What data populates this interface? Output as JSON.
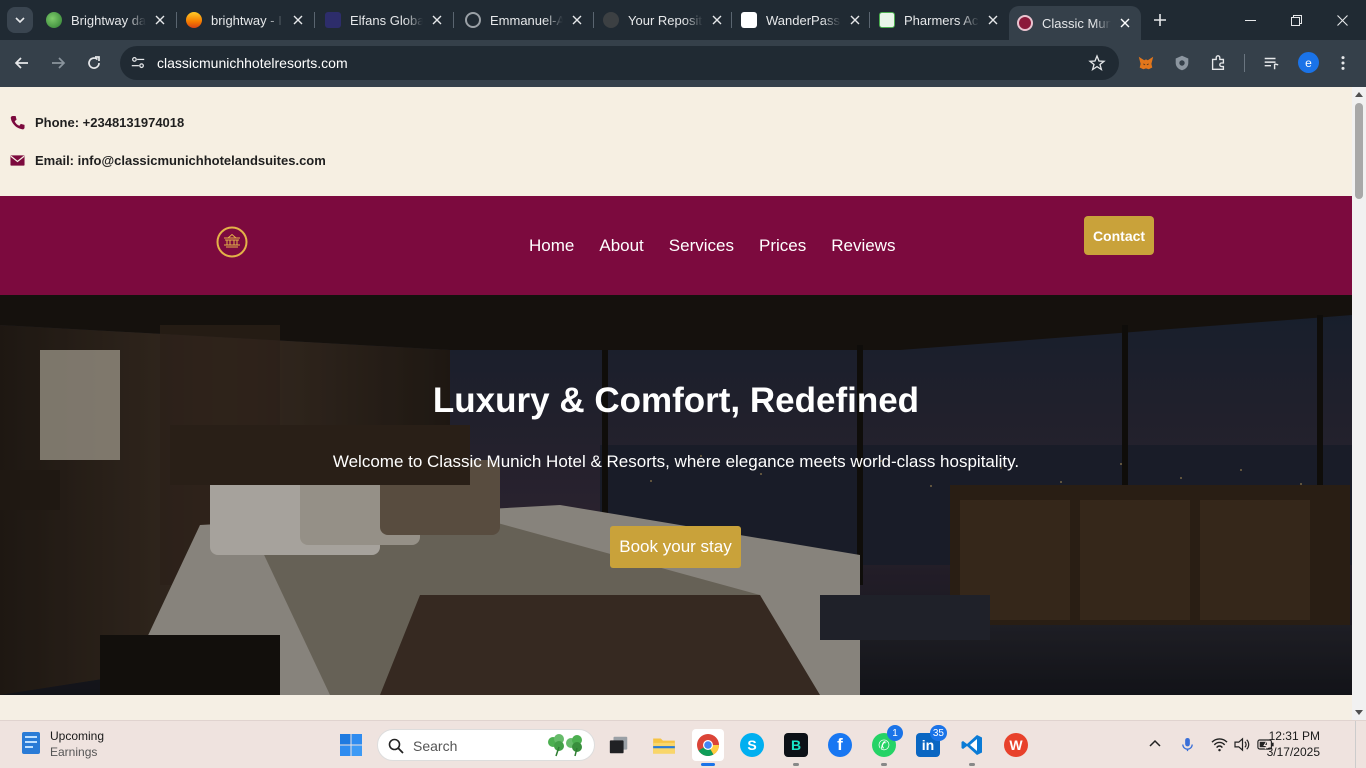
{
  "browser": {
    "tabs": [
      {
        "title": "Brightway da",
        "favicon_color": "#4caf50",
        "active": false
      },
      {
        "title": "brightway - I",
        "favicon_color": "#ff7a00",
        "active": false
      },
      {
        "title": "Elfans Global",
        "favicon_color": "#3b3b8f",
        "active": false
      },
      {
        "title": "Emmanuel-A",
        "favicon_color": "#9aa0a6",
        "active": false
      },
      {
        "title": "Your Reposit",
        "favicon_color": "#5f6368",
        "active": false
      },
      {
        "title": "WanderPass",
        "favicon_color": "#ffffff",
        "active": false
      },
      {
        "title": "Pharmers Ac",
        "favicon_color": "#e8f5e9",
        "active": false
      },
      {
        "title": "Classic Munic",
        "favicon_color": "#8b1a3a",
        "active": true
      }
    ],
    "url": "classicmunichhotelresorts.com",
    "profile_initial": "e",
    "icons": [
      "tab-search-icon",
      "back-icon",
      "forward-icon",
      "reload-icon",
      "site-info-icon",
      "bookmark-star-icon",
      "metamask-icon",
      "shield-extension-icon",
      "extensions-puzzle-icon",
      "media-controls-icon",
      "menu-icon"
    ]
  },
  "contact": {
    "phone": "Phone: +2348131974018",
    "email": "Email: info@classicmunichhotelandsuites.com"
  },
  "nav": {
    "links": [
      "Home",
      "About",
      "Services",
      "Prices",
      "Reviews"
    ],
    "contact_label": "Contact"
  },
  "hero": {
    "title": "Luxury & Comfort, Redefined",
    "subtitle": "Welcome to Classic Munich Hotel & Resorts, where elegance meets world-class hospitality.",
    "cta": "Book your stay"
  },
  "colors": {
    "brand_maroon": "#7c0a3e",
    "brand_gold": "#c9a23a",
    "cream": "#f6efe2"
  },
  "taskbar": {
    "widget_title": "Upcoming",
    "widget_sub": "Earnings",
    "search_placeholder": "Search",
    "apps": [
      {
        "name": "task-view",
        "badge": ""
      },
      {
        "name": "file-explorer",
        "badge": ""
      },
      {
        "name": "chrome",
        "badge": ""
      },
      {
        "name": "skype",
        "badge": ""
      },
      {
        "name": "brave-b",
        "badge": ""
      },
      {
        "name": "facebook",
        "badge": ""
      },
      {
        "name": "whatsapp",
        "badge": "1"
      },
      {
        "name": "linkedin",
        "badge": "35"
      },
      {
        "name": "vscode",
        "badge": ""
      },
      {
        "name": "wps-office",
        "badge": ""
      }
    ],
    "time": "12:31 PM",
    "date": "3/17/2025"
  }
}
